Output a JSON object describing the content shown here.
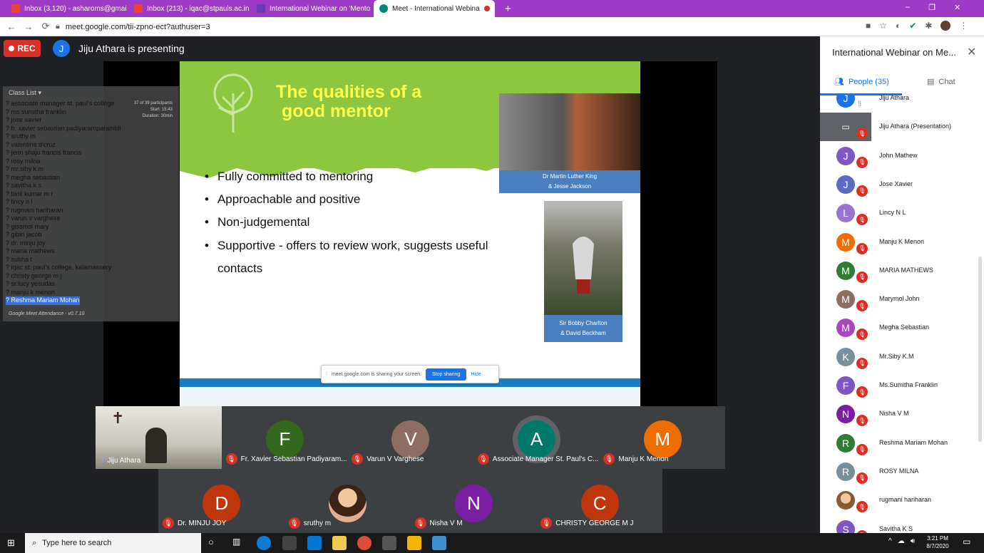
{
  "browser": {
    "tabs": [
      {
        "label": "Inbox (3,120) - asharoms@gmail",
        "color": "#ea4335"
      },
      {
        "label": "Inbox (213) - iqac@stpauls.ac.in",
        "color": "#ea4335"
      },
      {
        "label": "International Webinar on 'Mento",
        "color": "#673ab7"
      },
      {
        "label": "Meet - International Webina",
        "color": "#00897b"
      }
    ],
    "new_tab": "+",
    "url": "meet.google.com/tii-zpno-ect?authuser=3",
    "window_controls": [
      "–",
      "❐",
      "✕"
    ]
  },
  "meet_header": {
    "rec_label": "REC",
    "presenter_initial": "J",
    "presenting_text": "Jiju Athara is presenting"
  },
  "slide": {
    "title_line1": "The qualities of a",
    "title_line2": "good mentor",
    "bullets": [
      "Fully committed to mentoring",
      "Approachable and positive",
      "Non-judgemental",
      "Supportive - offers to review work, suggests useful contacts"
    ],
    "caption1_line1": "Dr Martin Luther King",
    "caption1_line2": "& Jesse Jackson",
    "caption2_line1": "Sir Bobby Charlton",
    "caption2_line2": "& David Beckham"
  },
  "share_bar": {
    "text": "meet.google.com is sharing your screen.",
    "stop_label": "Stop sharing",
    "hide_label": "Hide"
  },
  "extension": {
    "header": "Class List",
    "stats": [
      "37 of 39 participants",
      "Start: 15:43",
      "Duration: 30min"
    ],
    "entries": [
      "? associate manager st. paul's college",
      "? ms.sumitha franklin",
      "? jose xavier",
      "? fr. xavier sebastian padiyaramparambil",
      "? sruthy m",
      "? valentine d'cruz",
      "? jerin shaju francis francis",
      "? rosy milna",
      "? mr.siby k.m",
      "? megha sebastian",
      "? savitha k s",
      "? binil kumar m r",
      "? lincy n l",
      "? rugmani hariharan",
      "? varun v varghese",
      "? gissmol mary",
      "? gibin jacob",
      "? dr. minju joy",
      "? maria mathews",
      "? subha t",
      "? iqac st. paul's college, kalamassery",
      "? christy george m j",
      "? sr.lucy yesudas",
      "? manju k menon",
      "? Reshma Mariam Mohan"
    ],
    "footer": "Google Meet Attendance - v0.7.10"
  },
  "tiles_row1": [
    {
      "name": "Jiju Athara",
      "initial": "",
      "color": "#6d6a5e",
      "muted": false,
      "video": true
    },
    {
      "name": "Fr. Xavier Sebastian Padiyaram...",
      "initial": "F",
      "color": "#33691e",
      "muted": true
    },
    {
      "name": "Varun V Varghese",
      "initial": "V",
      "color": "#8d6e63",
      "muted": true
    },
    {
      "name": "Associate Manager St. Paul's C...",
      "initial": "A",
      "color": "#00796b",
      "muted": true
    },
    {
      "name": "Manju K Menon",
      "initial": "M",
      "color": "#ef6c00",
      "muted": true
    }
  ],
  "tiles_row2": [
    {
      "name": "Dr. MINJU JOY",
      "initial": "D",
      "color": "#bf360c",
      "muted": true
    },
    {
      "name": "sruthy m",
      "initial": "",
      "color": "#c9a27a",
      "muted": true,
      "photo": true
    },
    {
      "name": "Nisha V M",
      "initial": "N",
      "color": "#7b1fa2",
      "muted": true
    },
    {
      "name": "CHRISTY GEORGE M J",
      "initial": "C",
      "color": "#bf360c",
      "muted": true
    }
  ],
  "panel": {
    "title": "International Webinar on Me...",
    "close": "✕",
    "people_tab": "People (35)",
    "chat_tab": "Chat",
    "people": [
      {
        "name": "Jiju Athara",
        "initial": "J",
        "color": "#1a73e8",
        "speaking": true
      },
      {
        "name": "Jiju Athara (Presentation)",
        "initial": "▭",
        "color": "#5f6368",
        "presentation": true
      },
      {
        "name": "John Mathew",
        "initial": "J",
        "color": "#7e57c2"
      },
      {
        "name": "Jose Xavier",
        "initial": "J",
        "color": "#5c6bc0"
      },
      {
        "name": "Lincy N L",
        "initial": "L",
        "color": "#9575cd"
      },
      {
        "name": "Manju K Menon",
        "initial": "M",
        "color": "#ef6c00"
      },
      {
        "name": "MARIA MATHEWS",
        "initial": "M",
        "color": "#2e7d32"
      },
      {
        "name": "Marymol John",
        "initial": "M",
        "color": "#8d6e63"
      },
      {
        "name": "Megha Sebastian",
        "initial": "M",
        "color": "#ab47bc"
      },
      {
        "name": "Mr.Siby K.M",
        "initial": "K",
        "color": "#78909c"
      },
      {
        "name": "Ms.Sumitha Franklin",
        "initial": "F",
        "color": "#7e57c2"
      },
      {
        "name": "Nisha V M",
        "initial": "N",
        "color": "#7b1fa2"
      },
      {
        "name": "Reshma Mariam Mohan",
        "initial": "R",
        "color": "#2e7d32"
      },
      {
        "name": "ROSY MILNA",
        "initial": "R",
        "color": "#78909c"
      },
      {
        "name": "rugmani hariharan",
        "initial": "",
        "color": "#d7a96b"
      },
      {
        "name": "Savitha K S",
        "initial": "S",
        "color": "#7e57c2"
      }
    ]
  },
  "taskbar": {
    "search_placeholder": "Type here to search",
    "time": "3:21 PM",
    "date": "8/7/2020"
  }
}
